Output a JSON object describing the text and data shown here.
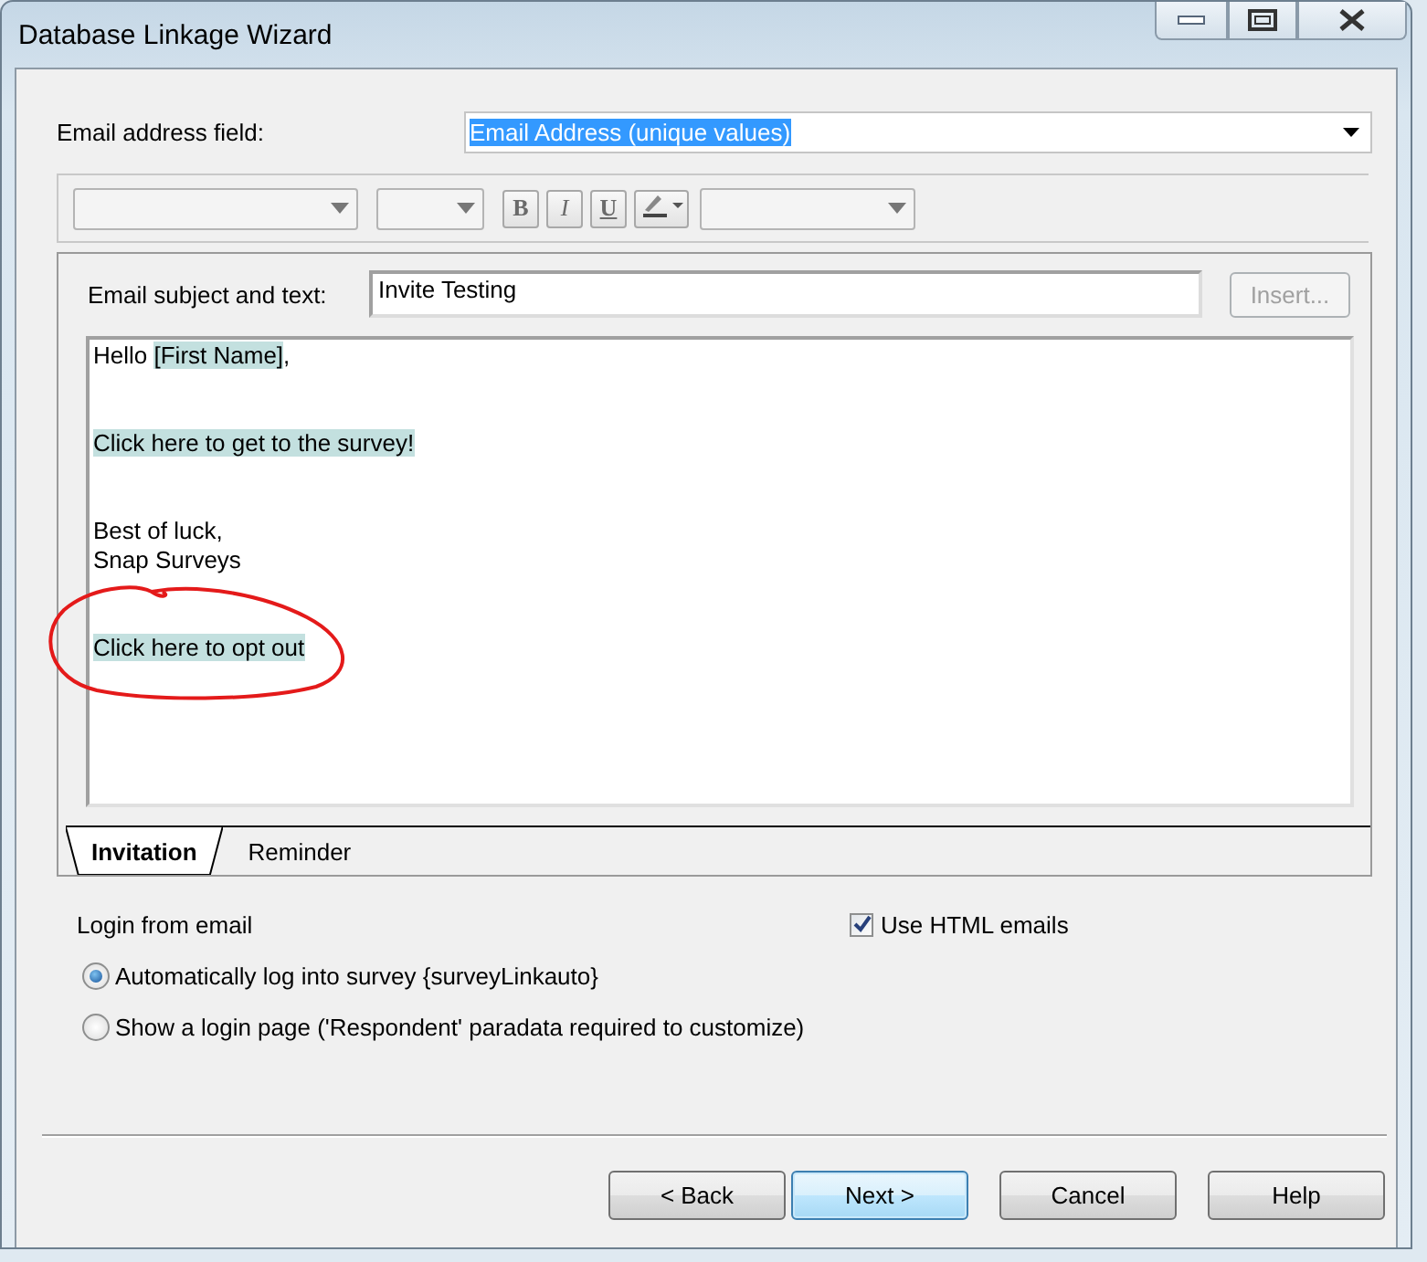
{
  "window": {
    "title": "Database Linkage Wizard"
  },
  "email_address_field": {
    "label": "Email address field:",
    "value": "Email Address (unique values)",
    "selected": true
  },
  "format_toolbar": {
    "buttons": [
      {
        "label": "B",
        "kind": "bold"
      },
      {
        "label": "I",
        "kind": "italic"
      },
      {
        "label": "U",
        "kind": "underline"
      }
    ]
  },
  "subject": {
    "label": "Email subject and text:",
    "value": "Invite Testing"
  },
  "insert_button": {
    "label": "Insert...",
    "disabled": true
  },
  "body": {
    "paragraphs": [
      [
        [
          {
            "text": "Hello ",
            "highlighted": false
          },
          {
            "text": "[First Name]",
            "highlighted": true
          },
          {
            "text": ",",
            "highlighted": false
          }
        ]
      ],
      [
        [
          {
            "text": "Click here to get to the survey!",
            "highlighted": true
          }
        ]
      ],
      [
        [
          {
            "text": "Best of luck,",
            "highlighted": false
          }
        ],
        [
          {
            "text": "Snap Surveys",
            "highlighted": false
          }
        ]
      ],
      [
        [
          {
            "text": "Click here to opt out",
            "highlighted": true
          }
        ]
      ]
    ]
  },
  "tabs": [
    {
      "label": "Invitation",
      "selected": true
    },
    {
      "label": "Reminder",
      "selected": false
    }
  ],
  "login": {
    "label": "Login from email",
    "options": [
      {
        "label": "Automatically log into survey {surveyLinkauto}",
        "selected": true
      },
      {
        "label": "Show a login page ('Respondent' paradata required to customize)",
        "selected": false
      }
    ]
  },
  "use_html_emails": {
    "label": "Use HTML emails",
    "checked": true
  },
  "buttons": [
    {
      "label": "< Back",
      "default": false
    },
    {
      "label": "Next >",
      "default": true
    },
    {
      "label": "Cancel",
      "default": false
    },
    {
      "label": "Help",
      "default": false
    }
  ]
}
